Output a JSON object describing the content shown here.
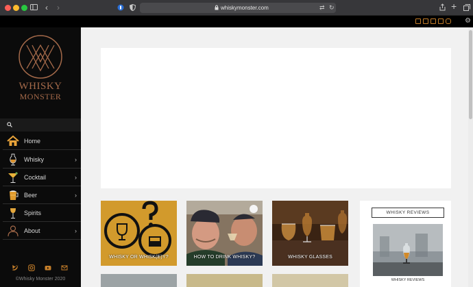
{
  "browser": {
    "url": "whiskymonster.com"
  },
  "colors": {
    "accent": "#c47e2a",
    "sidebar_bg": "#0b0b0b",
    "logo": "#a56a4a"
  },
  "logo": {
    "line1": "WHISKY",
    "line2": "MONSTER"
  },
  "nav": [
    {
      "label": "Home",
      "icon": "house-icon",
      "has_submenu": false
    },
    {
      "label": "Whisky",
      "icon": "whisky-glass-icon",
      "has_submenu": true
    },
    {
      "label": "Cocktail",
      "icon": "cocktail-glass-icon",
      "has_submenu": true
    },
    {
      "label": "Beer",
      "icon": "beer-mug-icon",
      "has_submenu": true
    },
    {
      "label": "Spirits",
      "icon": "spirits-glass-icon",
      "has_submenu": false
    },
    {
      "label": "About",
      "icon": "person-icon",
      "has_submenu": true
    }
  ],
  "sidebar_footer": {
    "copyright": "©Whisky Monster 2020"
  },
  "cards": [
    {
      "caption": "WHISKY OR WHISK(E)Y?"
    },
    {
      "caption": "HOW TO DRINK WHISKY?"
    },
    {
      "caption": "WHISKY GLASSES"
    }
  ],
  "widget": {
    "title": "WHISKY REVIEWS",
    "item_caption": "WHISKY REVIEWS"
  }
}
